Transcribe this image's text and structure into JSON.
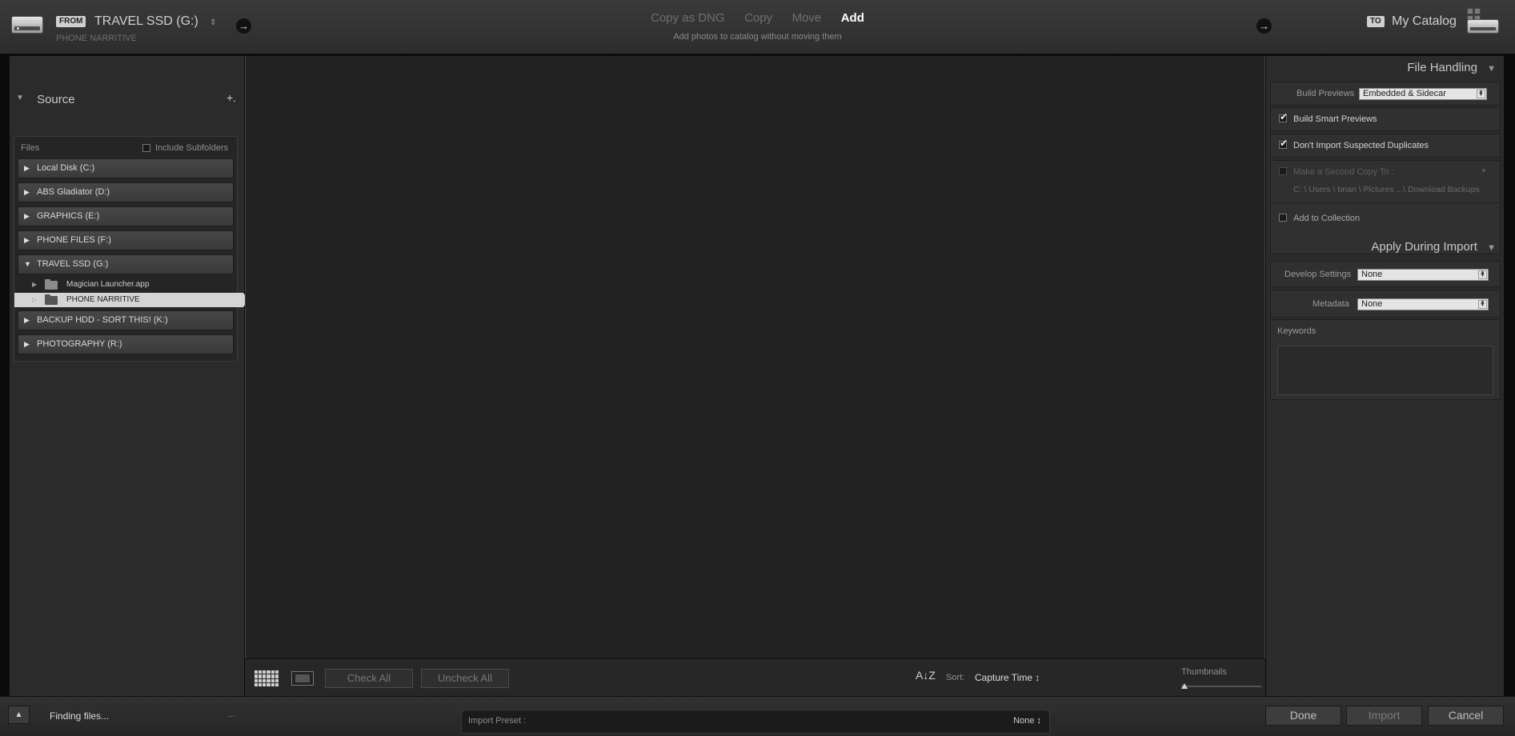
{
  "header": {
    "from_tag": "FROM",
    "from_drive": "TRAVEL SSD (G:)",
    "from_path": "PHONE NARRITIVE",
    "modes": [
      "Copy as DNG",
      "Copy",
      "Move",
      "Add"
    ],
    "active_mode": "Add",
    "mode_description": "Add photos to catalog without moving them",
    "to_tag": "TO",
    "to_catalog": "My Catalog"
  },
  "source": {
    "title": "Source",
    "add_symbol": "+.",
    "files_label": "Files",
    "include_subfolders": "Include Subfolders",
    "drives": [
      {
        "label": "Local Disk (C:)",
        "expanded": false
      },
      {
        "label": "ABS Gladiator (D:)",
        "expanded": false
      },
      {
        "label": "GRAPHICS (E:)",
        "expanded": false
      },
      {
        "label": "PHONE FILES (F:)",
        "expanded": false
      },
      {
        "label": "TRAVEL SSD (G:)",
        "expanded": true
      },
      {
        "label": "BACKUP HDD - SORT THIS! (K:)",
        "expanded": false
      },
      {
        "label": "PHOTOGRAPHY (R:)",
        "expanded": false
      }
    ],
    "folders": [
      {
        "label": "Magician Launcher.app",
        "selected": false
      },
      {
        "label": "PHONE NARRITIVE",
        "selected": true
      }
    ]
  },
  "toolbar": {
    "check_all": "Check All",
    "uncheck_all": "Uncheck All",
    "sort_icon": "A↓Z",
    "sort_label": "Sort:",
    "sort_value": "Capture Time ↕",
    "thumbnails_label": "Thumbnails"
  },
  "file_handling": {
    "title": "File Handling",
    "build_previews_label": "Build Previews",
    "build_previews_value": "Embedded & Sidecar",
    "build_smart_previews": "Build Smart Previews",
    "build_smart_previews_checked": true,
    "dont_import_duplicates": "Don't Import Suspected Duplicates",
    "dont_import_duplicates_checked": true,
    "second_copy": "Make a Second Copy To :",
    "second_copy_path": "C: \\ Users \\ brian \\ Pictures ...\\ Download Backups",
    "add_to_collection": "Add to Collection"
  },
  "apply_during_import": {
    "title": "Apply During Import",
    "develop_settings_label": "Develop Settings",
    "develop_settings_value": "None",
    "metadata_label": "Metadata",
    "metadata_value": "None",
    "keywords_label": "Keywords"
  },
  "bottom": {
    "status": "Finding files...",
    "spinner": "…",
    "import_preset_label": "Import Preset :",
    "import_preset_value": "None ↕",
    "done": "Done",
    "import": "Import",
    "cancel": "Cancel"
  }
}
